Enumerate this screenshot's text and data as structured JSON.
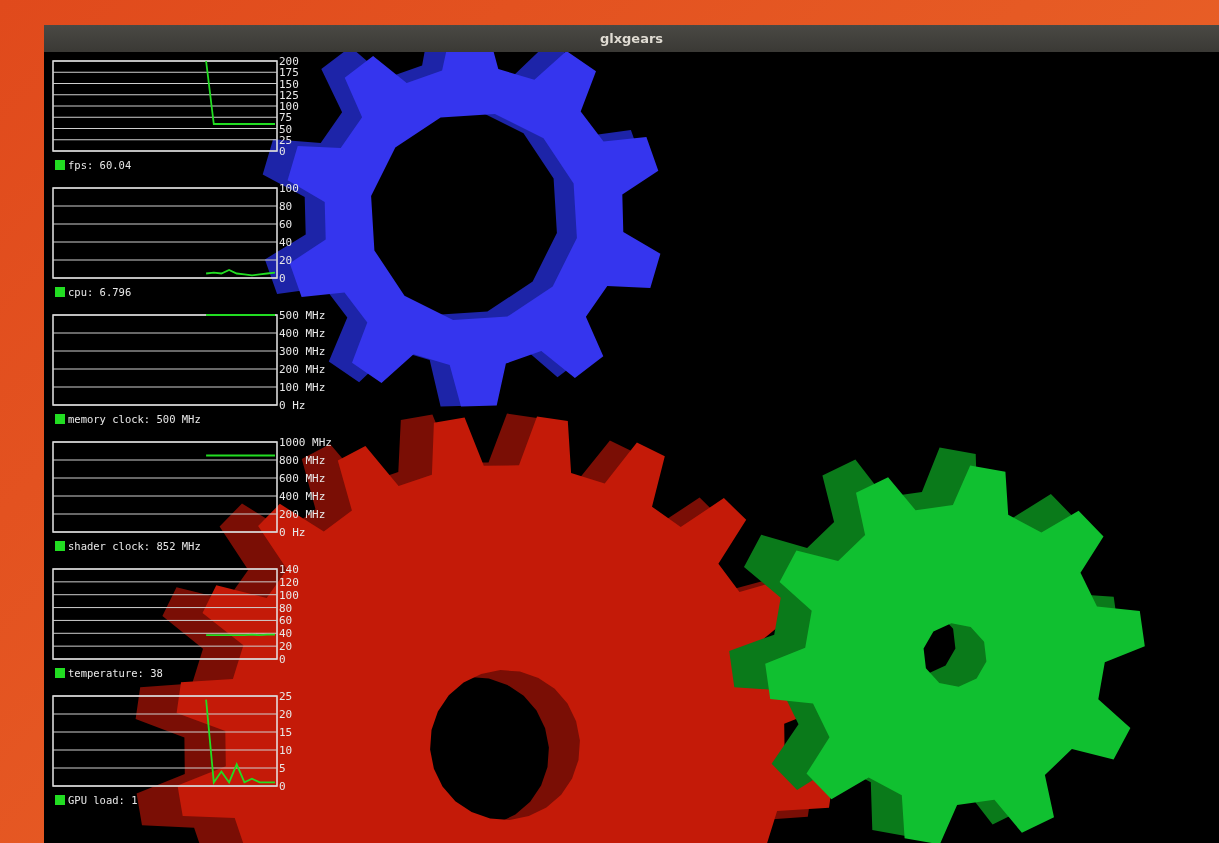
{
  "window": {
    "title": "glxgears"
  },
  "hud": [
    {
      "chart_data": {
        "type": "line",
        "grid": true,
        "ylim": [
          0,
          200
        ],
        "yticks": [
          0,
          25,
          50,
          75,
          100,
          125,
          150,
          175,
          200
        ],
        "series": [
          {
            "name": "fps: 60.04",
            "color": "#22dd22",
            "values": [
              null,
              null,
              null,
              null,
              null,
              null,
              null,
              null,
              null,
              null,
              null,
              null,
              null,
              null,
              null,
              null,
              null,
              null,
              null,
              null,
              200,
              60,
              60,
              60,
              60,
              60,
              60,
              60,
              60,
              60
            ]
          }
        ]
      }
    },
    {
      "chart_data": {
        "type": "line",
        "grid": true,
        "ylim": [
          0,
          100
        ],
        "yticks": [
          0,
          20,
          40,
          60,
          80,
          100
        ],
        "series": [
          {
            "name": "cpu: 6.796",
            "color": "#22dd22",
            "values": [
              null,
              null,
              null,
              null,
              null,
              null,
              null,
              null,
              null,
              null,
              null,
              null,
              null,
              null,
              null,
              null,
              null,
              null,
              null,
              null,
              5,
              6,
              5,
              9,
              5,
              4,
              3,
              4,
              5,
              6
            ]
          }
        ]
      }
    },
    {
      "chart_data": {
        "type": "line",
        "grid": true,
        "ylim": [
          0,
          500
        ],
        "yticks": [
          {
            "value": 0,
            "label": "0 Hz"
          },
          {
            "value": 100,
            "label": "100 MHz"
          },
          {
            "value": 200,
            "label": "200 MHz"
          },
          {
            "value": 300,
            "label": "300 MHz"
          },
          {
            "value": 400,
            "label": "400 MHz"
          },
          {
            "value": 500,
            "label": "500 MHz"
          }
        ],
        "series": [
          {
            "name": "memory clock: 500 MHz",
            "color": "#22dd22",
            "values": [
              null,
              null,
              null,
              null,
              null,
              null,
              null,
              null,
              null,
              null,
              null,
              null,
              null,
              null,
              null,
              null,
              null,
              null,
              null,
              null,
              500,
              500,
              500,
              500,
              500,
              500,
              500,
              500,
              500,
              500
            ]
          }
        ]
      }
    },
    {
      "chart_data": {
        "type": "line",
        "grid": true,
        "ylim": [
          0,
          1000
        ],
        "yticks": [
          {
            "value": 0,
            "label": "0 Hz"
          },
          {
            "value": 200,
            "label": "200 MHz"
          },
          {
            "value": 400,
            "label": "400 MHz"
          },
          {
            "value": 600,
            "label": "600 MHz"
          },
          {
            "value": 800,
            "label": "800 MHz"
          },
          {
            "value": 1000,
            "label": "1000 MHz"
          }
        ],
        "series": [
          {
            "name": "shader clock: 852 MHz",
            "color": "#22dd22",
            "values": [
              null,
              null,
              null,
              null,
              null,
              null,
              null,
              null,
              null,
              null,
              null,
              null,
              null,
              null,
              null,
              null,
              null,
              null,
              null,
              null,
              850,
              850,
              850,
              850,
              850,
              850,
              850,
              850,
              850,
              850
            ]
          }
        ]
      }
    },
    {
      "chart_data": {
        "type": "line",
        "grid": true,
        "ylim": [
          0,
          140
        ],
        "yticks": [
          0,
          20,
          40,
          60,
          80,
          100,
          120,
          140
        ],
        "series": [
          {
            "name": "temperature: 38",
            "color": "#22dd22",
            "values": [
              null,
              null,
              null,
              null,
              null,
              null,
              null,
              null,
              null,
              null,
              null,
              null,
              null,
              null,
              null,
              null,
              null,
              null,
              null,
              null,
              37,
              37,
              37,
              37,
              37,
              37,
              38,
              37,
              38,
              38
            ]
          }
        ]
      }
    },
    {
      "chart_data": {
        "type": "line",
        "grid": true,
        "ylim": [
          0,
          25
        ],
        "yticks": [
          0,
          5,
          10,
          15,
          20,
          25
        ],
        "series": [
          {
            "name": "GPU load: 1",
            "color": "#22dd22",
            "values": [
              null,
              null,
              null,
              null,
              null,
              null,
              null,
              null,
              null,
              null,
              null,
              null,
              null,
              null,
              null,
              null,
              null,
              null,
              null,
              null,
              24,
              1,
              4,
              1,
              6,
              1,
              2,
              1,
              1,
              1
            ]
          }
        ]
      }
    }
  ]
}
